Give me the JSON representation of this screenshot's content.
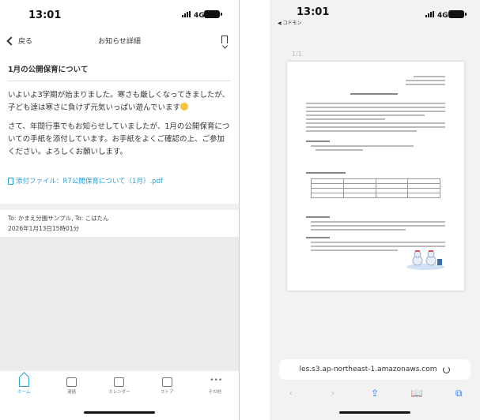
{
  "left": {
    "status": {
      "time": "13:01",
      "network": "4G"
    },
    "nav": {
      "back_label": "戻る",
      "title": "お知らせ詳細"
    },
    "post": {
      "title": "1月の公開保育について",
      "paragraph1": "いよいよ3学期が始まりました。寒さも厳しくなってきましたが、子ども達は寒さに負けず元気いっぱい遊んでいます",
      "paragraph2": "さて、年間行事でもお知らせしていましたが、1月の公開保育についての手紙を添付しています。お手紙をよくご確認の上、ご参加ください。よろしくお願いします。",
      "attachment": "添付ファイル：R7公開保育について（1月）.pdf",
      "recipients": "To: かまえ分園サンプル, To: こはたん",
      "datetime": "2026年1月13日15時01分"
    },
    "tabs": [
      {
        "label": "ホーム",
        "icon": "home-icon",
        "active": true
      },
      {
        "label": "連絡",
        "icon": "message-icon",
        "active": false
      },
      {
        "label": "カレンダー",
        "icon": "calendar-icon",
        "active": false
      },
      {
        "label": "ストア",
        "icon": "store-icon",
        "active": false
      },
      {
        "label": "その他",
        "icon": "more-icon",
        "active": false
      }
    ],
    "accent_color": "#2a9fd6"
  },
  "right": {
    "status": {
      "time": "13:01",
      "carrier": "◀ コドモン",
      "network": "4G"
    },
    "page_counter": "1/1",
    "url": "les.s3.ap-northeast-1.amazonaws.com",
    "toolbar_icons": [
      "back-icon",
      "forward-icon",
      "share-icon",
      "bookmarks-icon",
      "tabs-icon"
    ],
    "accent_color": "#2f7cf6"
  }
}
